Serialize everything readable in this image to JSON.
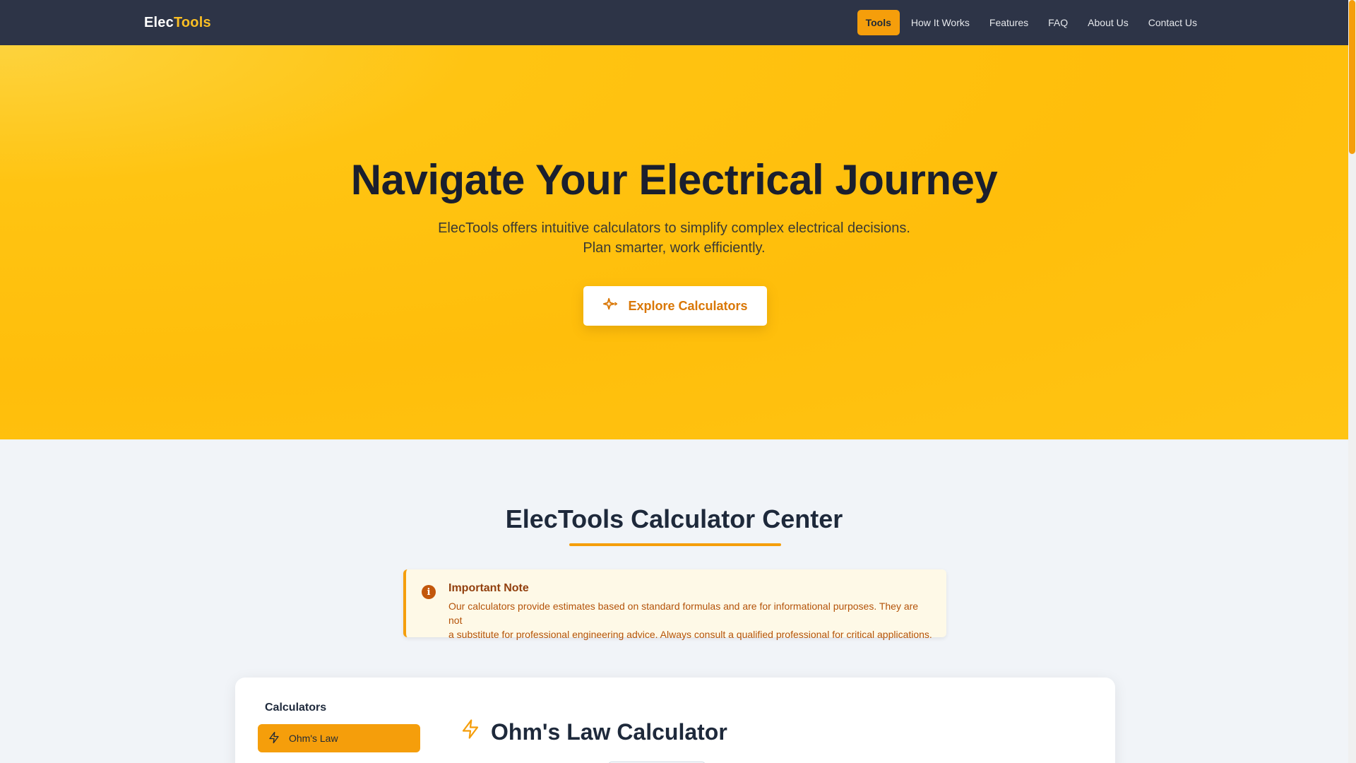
{
  "brand": {
    "part1": "Elec",
    "part2": "Tools"
  },
  "nav": {
    "items": [
      {
        "label": "Tools"
      },
      {
        "label": "How It Works"
      },
      {
        "label": "Features"
      },
      {
        "label": "FAQ"
      },
      {
        "label": "About Us"
      },
      {
        "label": "Contact Us"
      }
    ]
  },
  "hero": {
    "title": "Navigate Your Electrical Journey",
    "subtitle_line1": "ElecTools offers intuitive calculators to simplify complex electrical decisions.",
    "subtitle_line2": "Plan smarter, work efficiently.",
    "cta_label": "Explore Calculators",
    "cta_icon": "sparkle-icon"
  },
  "section": {
    "title": "ElecTools Calculator Center"
  },
  "note": {
    "icon": "info-icon",
    "title": "Important Note",
    "text_line1": "Our calculators provide estimates based on standard formulas and are for informational purposes. They are not",
    "text_line2": "a substitute for professional engineering advice. Always consult a qualified professional for critical applications."
  },
  "sidebar": {
    "title": "Calculators",
    "items": [
      {
        "label": "Ohm's Law",
        "icon": "lightning-icon"
      }
    ]
  },
  "calculator": {
    "title": "Ohm's Law Calculator",
    "icon": "lightning-icon"
  },
  "colors": {
    "accent": "#f59e0b",
    "navbar": "#2d3447",
    "hero": "#ffc412"
  }
}
